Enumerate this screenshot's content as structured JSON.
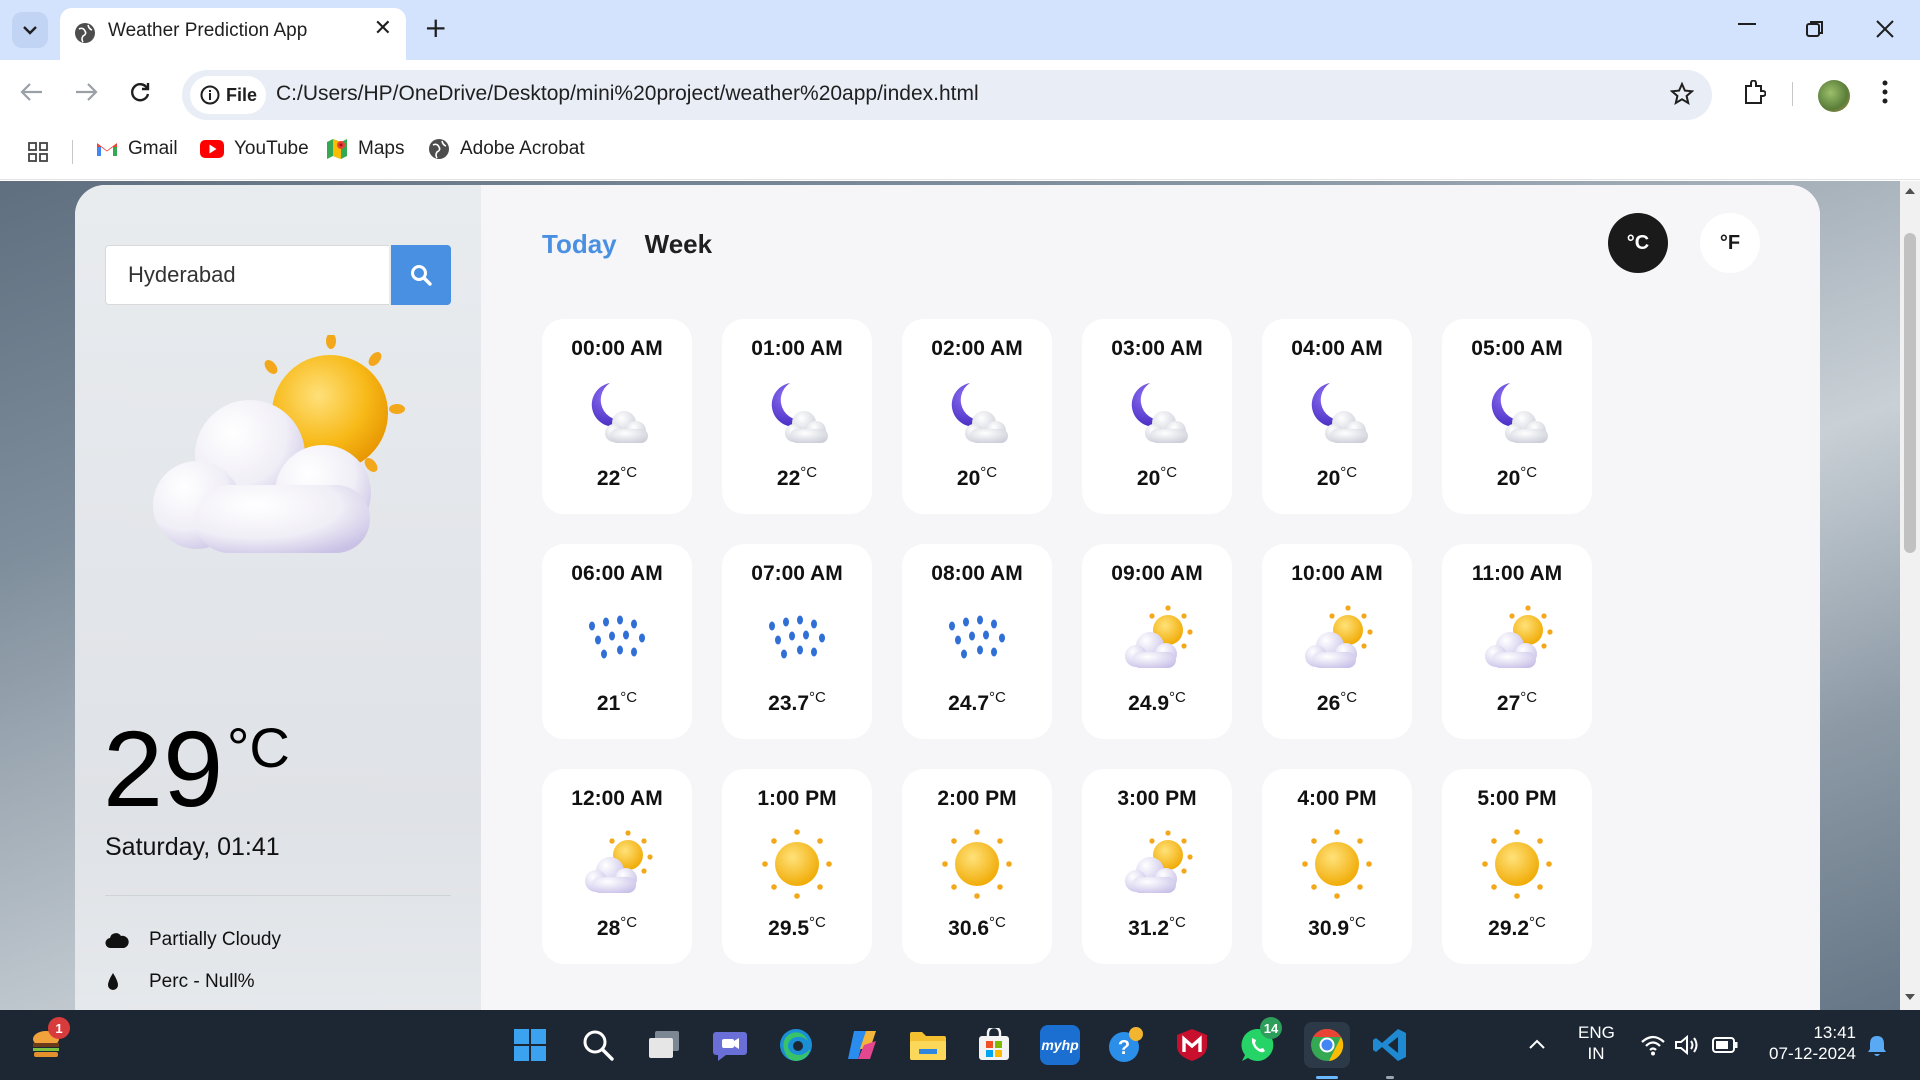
{
  "browser": {
    "tab_title": "Weather Prediction App",
    "new_tab_symbol": "+",
    "close_symbol": "✕",
    "address_chip": "File",
    "url": "C:/Users/HP/OneDrive/Desktop/mini%20project/weather%20app/index.html",
    "bookmarks": [
      {
        "label": "Gmail",
        "icon": "gmail-icon"
      },
      {
        "label": "YouTube",
        "icon": "youtube-icon"
      },
      {
        "label": "Maps",
        "icon": "maps-icon"
      },
      {
        "label": "Adobe Acrobat",
        "icon": "globe-icon"
      }
    ]
  },
  "app": {
    "search": {
      "value": "Hyderabad"
    },
    "current": {
      "temp": "29",
      "unit": "°C",
      "datetime": "Saturday, 01:41",
      "condition": "Partially Cloudy",
      "precipitation": "Perc - Null%",
      "icon": "partly-cloudy-icon"
    },
    "tabs": [
      "Today",
      "Week"
    ],
    "active_tab": "Today",
    "units": {
      "celsius": "°C",
      "fahrenheit": "°F",
      "active": "celsius"
    },
    "hours": [
      {
        "time": "00:00 AM",
        "temp": "22",
        "unit": "°C",
        "icon": "moon-cloud"
      },
      {
        "time": "01:00 AM",
        "temp": "22",
        "unit": "°C",
        "icon": "moon-cloud"
      },
      {
        "time": "02:00 AM",
        "temp": "20",
        "unit": "°C",
        "icon": "moon-cloud"
      },
      {
        "time": "03:00 AM",
        "temp": "20",
        "unit": "°C",
        "icon": "moon-cloud"
      },
      {
        "time": "04:00 AM",
        "temp": "20",
        "unit": "°C",
        "icon": "moon-cloud"
      },
      {
        "time": "05:00 AM",
        "temp": "20",
        "unit": "°C",
        "icon": "moon-cloud"
      },
      {
        "time": "06:00 AM",
        "temp": "21",
        "unit": "°C",
        "icon": "rain"
      },
      {
        "time": "07:00 AM",
        "temp": "23.7",
        "unit": "°C",
        "icon": "rain"
      },
      {
        "time": "08:00 AM",
        "temp": "24.7",
        "unit": "°C",
        "icon": "rain"
      },
      {
        "time": "09:00 AM",
        "temp": "24.9",
        "unit": "°C",
        "icon": "sun-cloud"
      },
      {
        "time": "10:00 AM",
        "temp": "26",
        "unit": "°C",
        "icon": "sun-cloud"
      },
      {
        "time": "11:00 AM",
        "temp": "27",
        "unit": "°C",
        "icon": "sun-cloud"
      },
      {
        "time": "12:00 AM",
        "temp": "28",
        "unit": "°C",
        "icon": "sun-cloud"
      },
      {
        "time": "1:00 PM",
        "temp": "29.5",
        "unit": "°C",
        "icon": "sun"
      },
      {
        "time": "2:00 PM",
        "temp": "30.6",
        "unit": "°C",
        "icon": "sun"
      },
      {
        "time": "3:00 PM",
        "temp": "31.2",
        "unit": "°C",
        "icon": "sun-cloud"
      },
      {
        "time": "4:00 PM",
        "temp": "30.9",
        "unit": "°C",
        "icon": "sun"
      },
      {
        "time": "5:00 PM",
        "temp": "29.2",
        "unit": "°C",
        "icon": "sun"
      }
    ]
  },
  "taskbar": {
    "widget_badge": "1",
    "whatsapp_badge": "14",
    "myhp_label": "myhp",
    "lang_line1": "ENG",
    "lang_line2": "IN",
    "time": "13:41",
    "date": "07-12-2024"
  },
  "colors": {
    "accent": "#4a90e2",
    "tabbar": "#d3e3fd",
    "taskbar": "#1c2733",
    "moon": "#5b3fd9",
    "sun": "#f5b800",
    "rain": "#2f6fd6"
  }
}
